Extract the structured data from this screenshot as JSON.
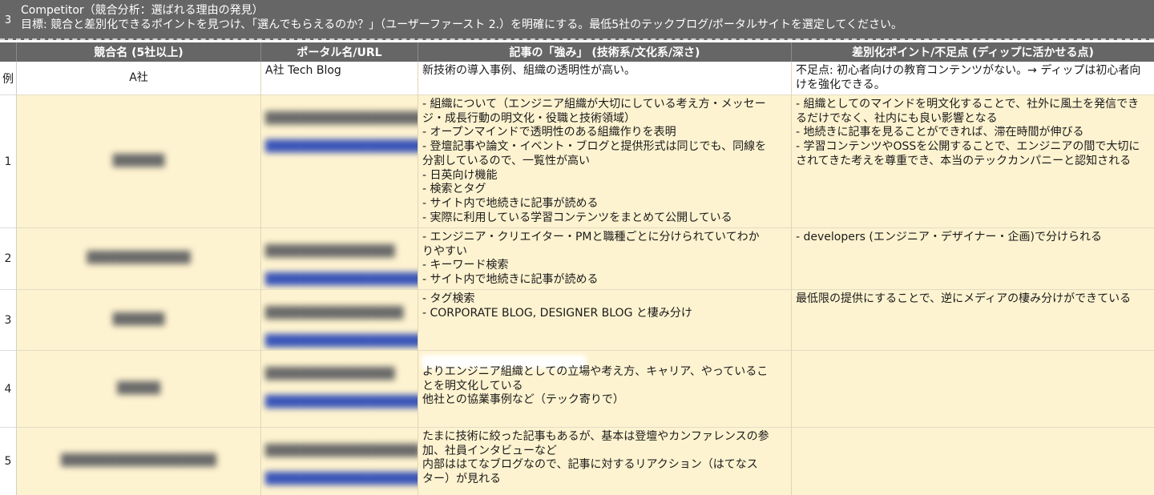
{
  "section": {
    "number": "3",
    "title": "Competitor（競合分析：選ばれる理由の発見）",
    "goal": "目標: 競合と差別化できるポイントを見つけ、「選んでもらえるのか？」（ユーザーファースト 2.）を明確にする。最低5社のテックブログ/ポータルサイトを選定してください。"
  },
  "columns": {
    "competitor": "競合名 (5社以上)",
    "portal": "ポータル名/URL",
    "strengths": "記事の「強み」 (技術系/文化系/深さ)",
    "diff": "差別化ポイント/不足点 (ディップに活かせる点)"
  },
  "rows": [
    {
      "num": "例",
      "competitor": "A社",
      "portal": "A社 Tech Blog",
      "strengths": "新技術の導入事例、組織の透明性が高い。",
      "diff": "不足点: 初心者向けの教育コンテンツがない。→ ディップは初心者向\nけを強化できる。"
    },
    {
      "num": "1",
      "competitor": "██████",
      "portal": "████████████████████",
      "portal_url": "████████████████████████████",
      "strengths": "- 組織について（エンジニア組織が大切にしている考え方・メッセー\nジ・成長行動の明文化・役職と技術領域）\n- オープンマインドで透明性のある組織作りを表明\n- 登壇記事や論文・イベント・ブログと提供形式は同じでも、同線を\n分割しているので、一覧性が高い\n- 日英向け機能\n- 検索とタグ\n- サイト内で地続きに記事が読める\n- 実際に利用している学習コンテンツをまとめて公開している",
      "diff": "- 組織としてのマインドを明文化することで、社外に風土を発信でき\nるだけでなく、社内にも良い影響となる\n- 地続きに記事を見ることができれば、滞在時間が伸びる\n- 学習コンテンツやOSSを公開することで、エンジニアの間で大切に\nされてきた考えを尊重でき、本当のテックカンパニーと認知される"
    },
    {
      "num": "2",
      "competitor": "████████████",
      "portal": "███████████████",
      "portal_url": "█████████████████████████",
      "strengths": "- エンジニア・クリエイター・PMと職種ごとに分けられていてわか\nりやすい\n- キーワード検索\n- サイト内で地続きに記事が読める",
      "diff": "- developers (エンジニア・デザイナー・企画)で分けられる"
    },
    {
      "num": "3",
      "competitor": "██████",
      "portal": "████████████████",
      "portal_url": "██████████████████████",
      "strengths": "- タグ検索\n- CORPORATE BLOG, DESIGNER BLOG と棲み分け",
      "diff": "最低限の提供にすることで、逆にメディアの棲み分けができている"
    },
    {
      "num": "4",
      "competitor": "█████",
      "portal": "███████████████",
      "portal_url": "██████████████████████",
      "strengths": "よりエンジニア組織としての立場や考え方、キャリア、やっているこ\nとを明文化している\n他社との協業事例など（テック寄りで）",
      "diff": ""
    },
    {
      "num": "5",
      "competitor": "██████████████████",
      "portal": "██████████████████",
      "portal_url": "█████████████████████",
      "strengths": "たまに技術に絞った記事もあるが、基本は登壇やカンファレンスの参\n加、社員インタビューなど\n内部ははてなブログなので、記事に対するリアクション（はてなス\nター）が見れる",
      "diff": ""
    }
  ]
}
